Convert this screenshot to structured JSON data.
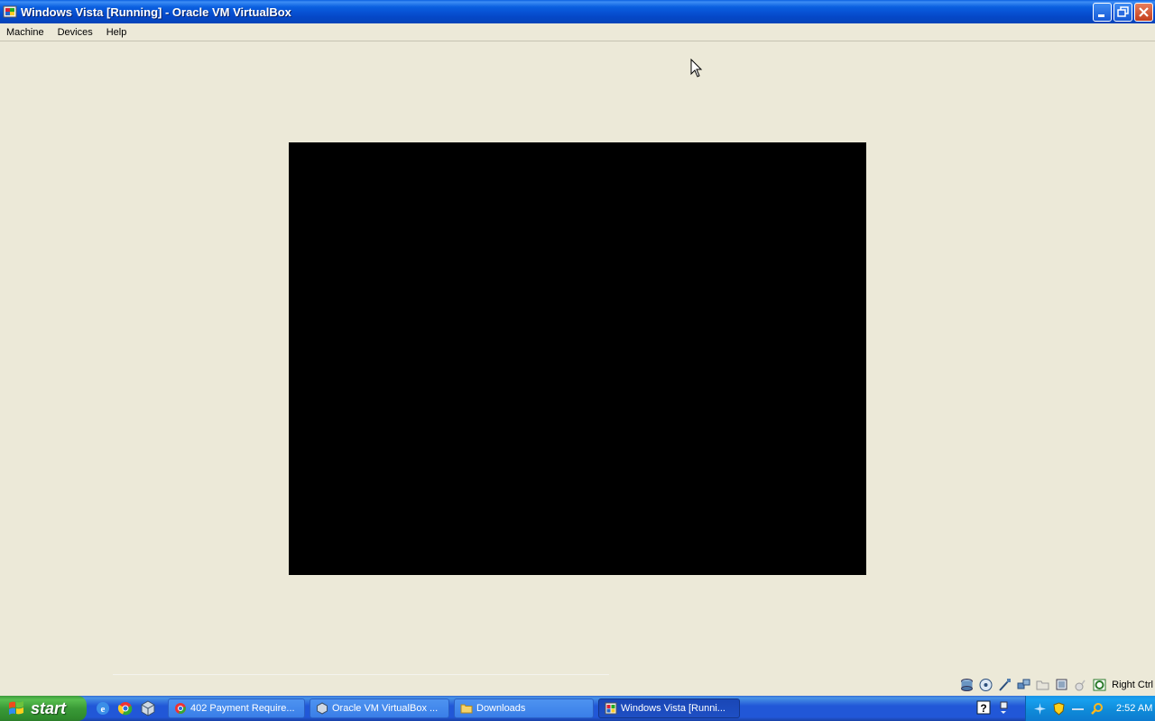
{
  "window": {
    "title": "Windows Vista [Running] - Oracle VM VirtualBox"
  },
  "menubar": {
    "items": [
      {
        "label": "Machine"
      },
      {
        "label": "Devices"
      },
      {
        "label": "Help"
      }
    ]
  },
  "statusbar": {
    "host_key": "Right Ctrl",
    "icons": [
      "hard-disk-icon",
      "optical-drive-icon",
      "usb-icon",
      "network-icon",
      "shared-folders-icon",
      "display-icon",
      "mouse-integration-icon",
      "virtualization-icon"
    ]
  },
  "taskbar": {
    "start_label": "start",
    "quicklaunch": [
      "ie-icon",
      "chrome-icon",
      "virtualbox-icon"
    ],
    "tasks": [
      {
        "label": "402 Payment Require...",
        "icon": "chrome-icon"
      },
      {
        "label": "Oracle VM VirtualBox ...",
        "icon": "virtualbox-icon"
      },
      {
        "label": "Downloads",
        "icon": "folder-icon"
      },
      {
        "label": "Windows Vista [Runni...",
        "icon": "vm-window-icon"
      }
    ],
    "clock": "2:52 AM"
  },
  "colors": {
    "titlebar": "#0a5fe0",
    "chrome": "#ece9d8",
    "vm_screen": "#000000",
    "taskbar": "#2157d7",
    "start": "#3a9a37"
  }
}
